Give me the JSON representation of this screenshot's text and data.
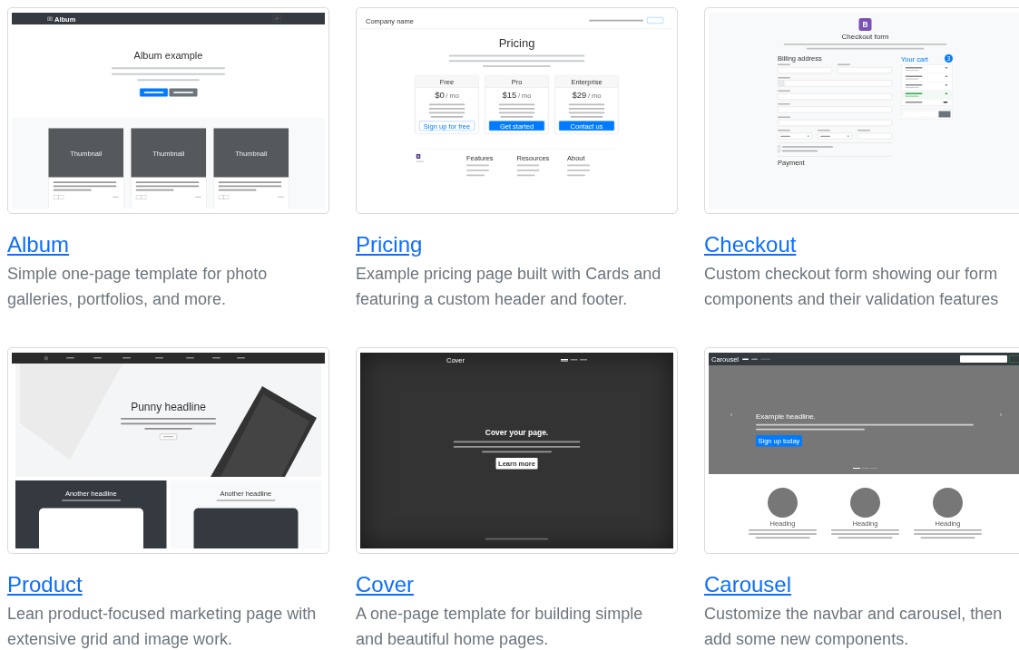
{
  "examples": [
    {
      "title": "Album",
      "description": "Simple one-page template for photo galleries, portfolios, and more.",
      "preview": {
        "kind": "album",
        "brand": "Album",
        "heading": "Album example",
        "buttons": [
          {
            "kind": "primary"
          },
          {
            "kind": "secondary"
          }
        ],
        "cards": [
          {
            "image_label": "Thumbnail"
          },
          {
            "image_label": "Thumbnail"
          },
          {
            "image_label": "Thumbnail"
          }
        ]
      }
    },
    {
      "title": "Pricing",
      "description": "Example pricing page built with Cards and featuring a custom header and footer.",
      "preview": {
        "kind": "pricing",
        "brand": "Company name",
        "heading": "Pricing",
        "plans": [
          {
            "name": "Free",
            "price": "$0",
            "unit": "/ mo",
            "button": {
              "label": "Sign up for free",
              "kind": "outline"
            }
          },
          {
            "name": "Pro",
            "price": "$15",
            "unit": "/ mo",
            "button": {
              "label": "Get started",
              "kind": "primary"
            }
          },
          {
            "name": "Enterprise",
            "price": "$29",
            "unit": "/ mo",
            "button": {
              "label": "Contact us",
              "kind": "primary"
            }
          }
        ],
        "footer_headings": [
          "Features",
          "Resources",
          "About"
        ]
      }
    },
    {
      "title": "Checkout",
      "description": "Custom checkout form showing our form components and their validation features",
      "preview": {
        "kind": "checkout",
        "logo": "B",
        "heading": "Checkout form",
        "billing_heading": "Billing address",
        "rows": [
          [
            {
              "kind": "text"
            },
            {
              "kind": "text"
            }
          ],
          [
            {
              "kind": "addon"
            }
          ],
          [
            {
              "kind": "text"
            }
          ],
          [
            {
              "kind": "text"
            }
          ],
          [
            {
              "kind": "text"
            }
          ],
          [
            {
              "kind": "select"
            },
            {
              "kind": "select"
            },
            {
              "kind": "text"
            }
          ]
        ],
        "checkboxes": [
          {
            "checked": false
          },
          {
            "checked": false
          }
        ],
        "payment_heading": "Payment",
        "cart_heading": "Your cart",
        "cart_count": "3",
        "cart": [
          {
            "kind": "item"
          },
          {
            "kind": "item"
          },
          {
            "kind": "item"
          },
          {
            "kind": "promo"
          },
          {
            "kind": "total"
          }
        ]
      }
    },
    {
      "title": "Product",
      "description": "Lean product-focused marketing page with extensive grid and image work.",
      "preview": {
        "kind": "product",
        "heading": "Punny headline",
        "panels": [
          {
            "heading": "Another headline",
            "dark": true
          },
          {
            "heading": "Another headline",
            "dark": false
          }
        ]
      }
    },
    {
      "title": "Cover",
      "description": "A one-page template for building simple and beautiful home pages.",
      "preview": {
        "kind": "cover",
        "brand": "Cover",
        "nav": [
          {
            "selected": true
          },
          {
            "selected": false
          },
          {
            "selected": false
          }
        ],
        "heading": "Cover your page.",
        "button": "Learn more"
      }
    },
    {
      "title": "Carousel",
      "description": "Customize the navbar and carousel, then add some new components.",
      "preview": {
        "kind": "carousel",
        "brand": "Carousel",
        "nav": [
          {
            "selected": true,
            "disabled": false
          },
          {
            "selected": false,
            "disabled": false
          },
          {
            "selected": false,
            "disabled": true
          }
        ],
        "prev": "‹",
        "next": "›",
        "heading": "Example headline.",
        "button": "Sign up today",
        "indicators": [
          {
            "selected": true
          },
          {
            "selected": false
          },
          {
            "selected": false
          }
        ],
        "columns": [
          {
            "heading": "Heading"
          },
          {
            "heading": "Heading"
          },
          {
            "heading": "Heading"
          }
        ]
      }
    }
  ]
}
